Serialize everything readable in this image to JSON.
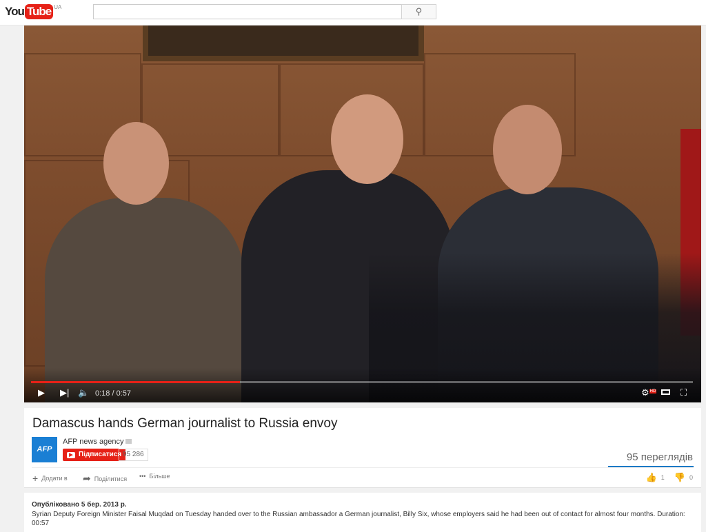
{
  "header": {
    "logo_you": "You",
    "logo_tube": "Tube",
    "country": "UA",
    "search_placeholder": "",
    "search_icon": "magnifier-icon"
  },
  "player": {
    "current_time": "0:18",
    "duration": "0:57",
    "time_display": "0:18 / 0:57",
    "progress_percent": 31.6,
    "hd_badge": "HD"
  },
  "video": {
    "title": "Damascus hands German journalist to Russia envoy",
    "channel": "AFP news agency",
    "avatar_text": "AFP",
    "subscribe_label": "Підписатися",
    "subscriber_count": "95 286",
    "views": "95 переглядів",
    "actions": [
      {
        "label": "Додати в",
        "icon": "plus-icon"
      },
      {
        "label": "Поділитися",
        "icon": "share-icon"
      },
      {
        "label": "Більше",
        "icon": "more-icon"
      }
    ],
    "likes": "1",
    "dislikes": "0",
    "accent": "#e62117"
  },
  "description": {
    "published": "Опубліковано 5 бер. 2013 р.",
    "text": "Syrian Deputy Foreign Minister Faisal Muqdad on Tuesday handed over to the Russian ambassador a German journalist, Billy Six, whose employers said he had been out of contact for almost four months. Duration: 00:57"
  }
}
